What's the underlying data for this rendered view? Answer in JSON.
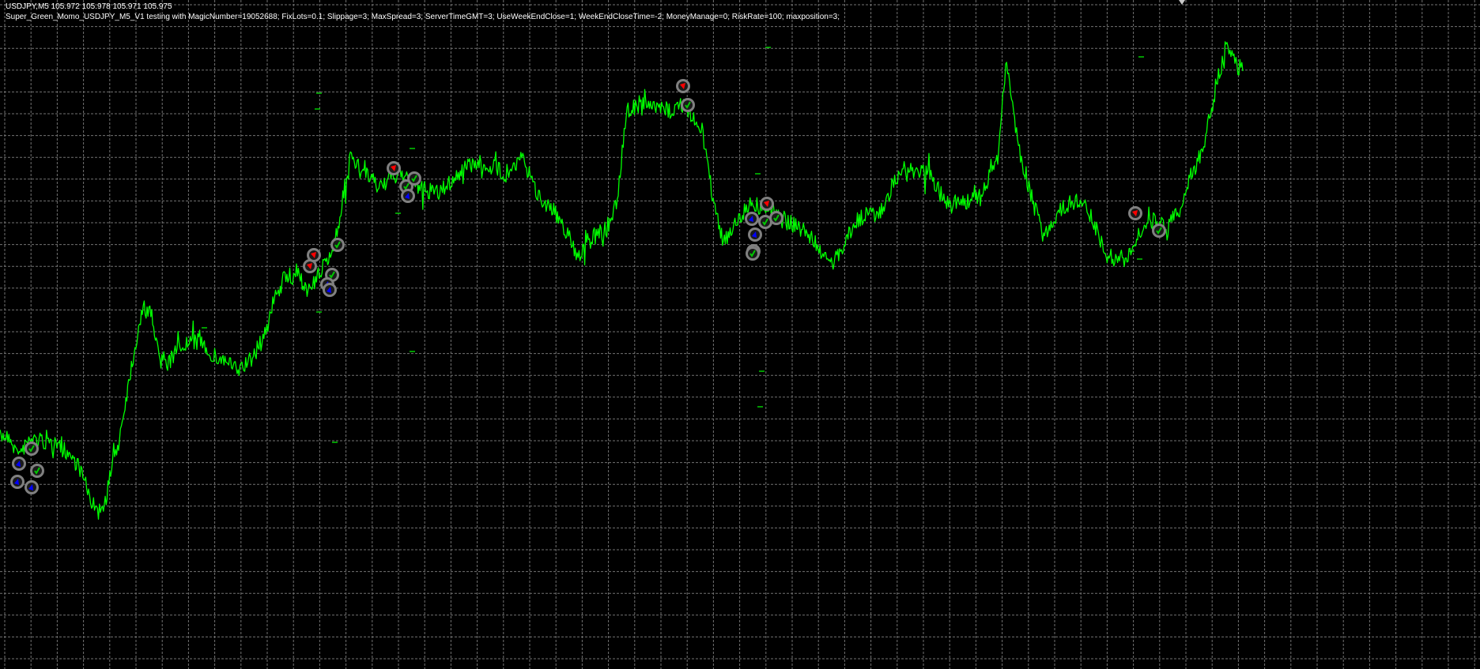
{
  "header": {
    "symbol_line": "USDJPY,M5  105.972 105.978 105.971 105.975",
    "expert_line": "Super_Green_Momo_USDJPY_M5_V1 testing with MagicNumber=19052688; FixLots=0.1; Slippage=3; MaxSpread=3; ServerTimeGMT=3; UseWeekEndClose=1; WeekEndCloseTime=-2; MoneyManage=0; RiskRate=100; maxposition=3;"
  },
  "chart": {
    "symbol": "USDJPY",
    "timeframe": "M5",
    "last_bar": {
      "open": 105.972,
      "high": 105.978,
      "low": 105.971,
      "close": 105.975
    },
    "chart_type": "line",
    "grid": true,
    "colors": {
      "background": "#000000",
      "grid": "#7f7f7f",
      "price_line": "#00ff00",
      "trade_marker_ring": "#808080",
      "buy_arrow": "#0000ff",
      "sell_arrow": "#ff0000",
      "close_check": "#00c800",
      "text": "#ffffff"
    }
  },
  "trade_markers": [
    {
      "type": "buy"
    },
    {
      "type": "buy"
    },
    {
      "type": "close"
    },
    {
      "type": "close"
    },
    {
      "type": "buy"
    },
    {
      "type": "sell"
    },
    {
      "type": "close"
    },
    {
      "type": "close"
    },
    {
      "type": "buy"
    },
    {
      "type": "sell"
    },
    {
      "type": "sell"
    },
    {
      "type": "close"
    },
    {
      "type": "close"
    },
    {
      "type": "buy"
    },
    {
      "type": "buy"
    },
    {
      "type": "sell"
    },
    {
      "type": "close"
    },
    {
      "type": "sell"
    },
    {
      "type": "buy"
    },
    {
      "type": "close"
    },
    {
      "type": "close"
    },
    {
      "type": "buy"
    },
    {
      "type": "buy"
    },
    {
      "type": "close"
    },
    {
      "type": "sell"
    },
    {
      "type": "close"
    }
  ]
}
